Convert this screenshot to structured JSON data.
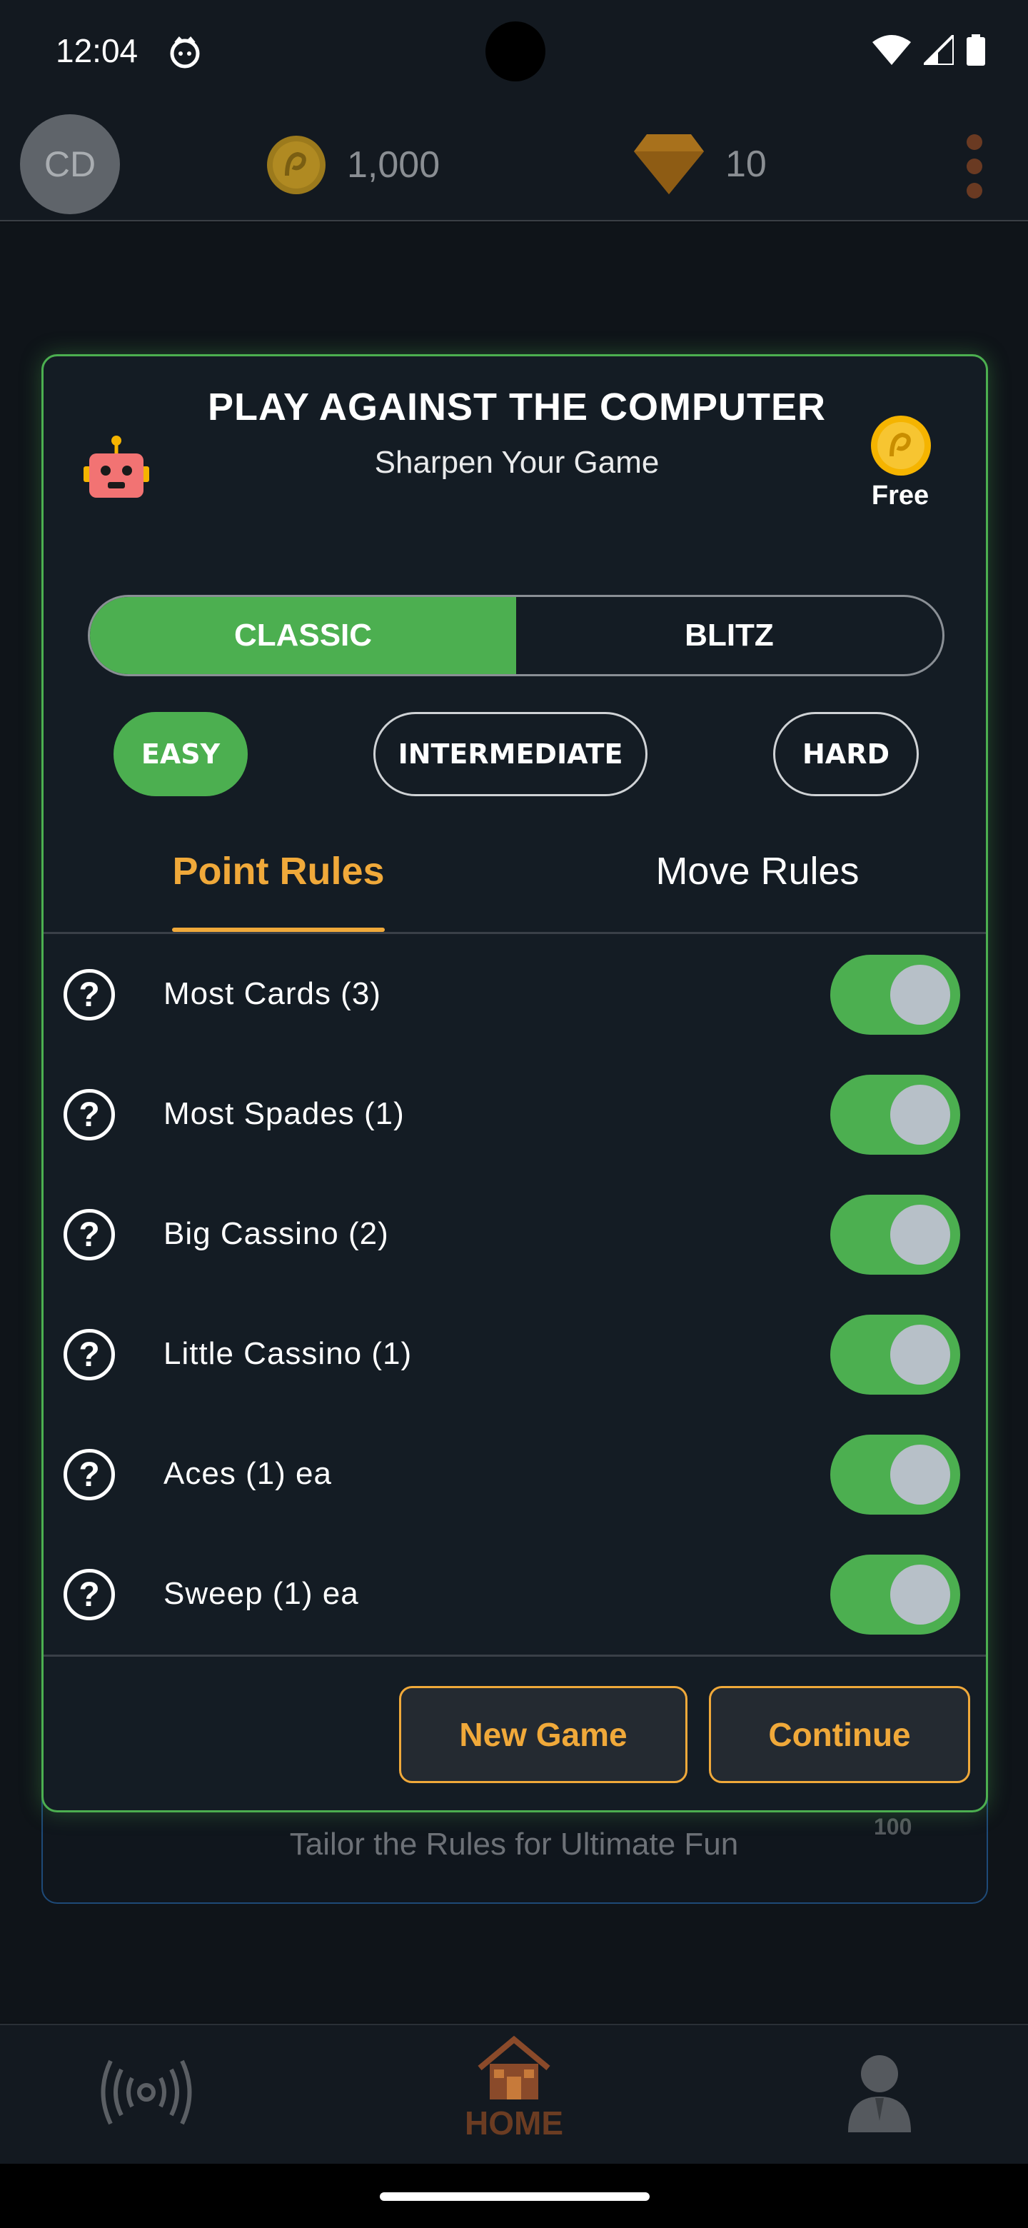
{
  "status_bar": {
    "time": "12:04",
    "icons": [
      "face-icon",
      "wifi-icon",
      "signal-icon",
      "battery-icon"
    ]
  },
  "top_bar": {
    "avatar_initials": "CD",
    "coins": "1,000",
    "gems": "10",
    "coin_icon": "coin-icon",
    "gem_icon": "gem-icon",
    "menu_icon": "kebab-menu-icon"
  },
  "behind": {
    "subtitle": "Tailor the Rules for Ultimate Fun",
    "number": "100"
  },
  "modal": {
    "title": "PLAY AGAINST THE COMPUTER",
    "subtitle": "Sharpen Your Game",
    "fee": "Free",
    "modes": [
      {
        "label": "CLASSIC",
        "active": true
      },
      {
        "label": "BLITZ",
        "active": false
      }
    ],
    "levels": [
      {
        "label": "EASY",
        "active": true
      },
      {
        "label": "INTERMEDIATE",
        "active": false
      },
      {
        "label": "HARD",
        "active": false
      }
    ],
    "tabs": [
      {
        "label": "Point Rules",
        "active": true
      },
      {
        "label": "Move Rules",
        "active": false
      }
    ],
    "rules": [
      {
        "label": "Most Cards (3)",
        "enabled": true
      },
      {
        "label": "Most Spades (1)",
        "enabled": true
      },
      {
        "label": "Big Cassino (2)",
        "enabled": true
      },
      {
        "label": "Little Cassino (1)",
        "enabled": true
      },
      {
        "label": "Aces (1) ea",
        "enabled": true
      },
      {
        "label": "Sweep (1) ea",
        "enabled": true
      }
    ],
    "buttons": {
      "new_game": "New Game",
      "continue": "Continue"
    }
  },
  "bottom_nav": {
    "home_label": "HOME",
    "items": [
      "live-icon",
      "home-icon",
      "profile-icon"
    ]
  },
  "colors": {
    "accent_green": "#4caf50",
    "accent_orange": "#f0a93a",
    "modal_bg": "#141c24"
  }
}
